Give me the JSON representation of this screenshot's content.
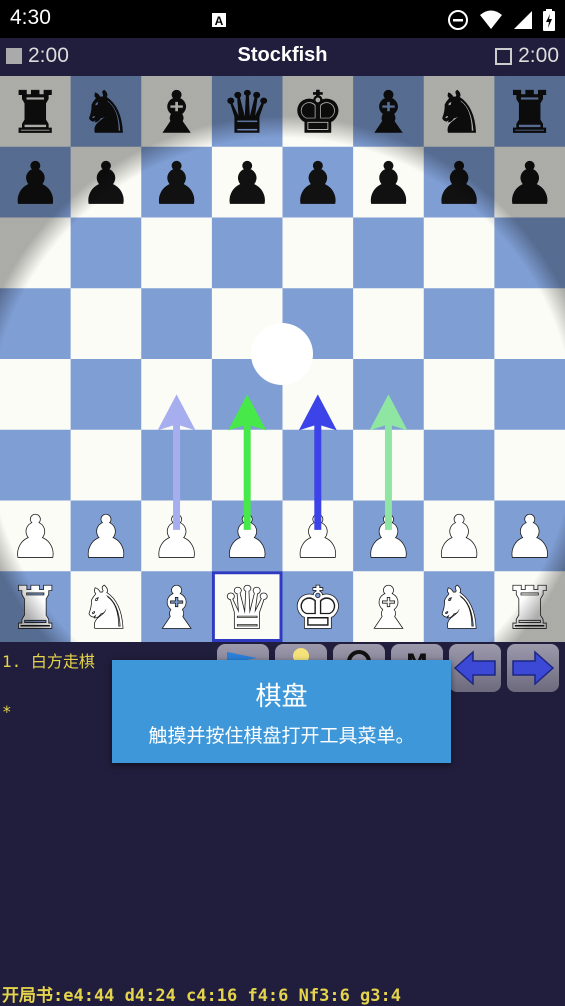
{
  "status_bar": {
    "time": "4:30",
    "icons": [
      "notification-a-icon",
      "do-not-disturb-icon",
      "wifi-icon",
      "signal-icon",
      "battery-charging-icon"
    ]
  },
  "clock_bar": {
    "left_time": "2:00",
    "engine_name": "Stockfish",
    "right_time": "2:00"
  },
  "board": {
    "colors": {
      "light": "#fcfcf6",
      "dark": "#7f9ed4",
      "highlight": "#2e3ac0"
    },
    "ranks": [
      [
        "br",
        "bn",
        "bb",
        "bq",
        "bk",
        "bb",
        "bn",
        "br"
      ],
      [
        "bp",
        "bp",
        "bp",
        "bp",
        "bp",
        "bp",
        "bp",
        "bp"
      ],
      [
        "",
        "",
        "",
        "",
        "",
        "",
        "",
        ""
      ],
      [
        "",
        "",
        "",
        "",
        "",
        "",
        "",
        ""
      ],
      [
        "",
        "",
        "",
        "",
        "",
        "",
        "",
        ""
      ],
      [
        "",
        "",
        "",
        "",
        "",
        "",
        "",
        ""
      ],
      [
        "wp",
        "wp",
        "wp",
        "wp",
        "wp",
        "wp",
        "wp",
        "wp"
      ],
      [
        "wr",
        "wn",
        "wb",
        "wq",
        "wk",
        "wb",
        "wn",
        "wr"
      ]
    ],
    "highlighted_square": "d1",
    "arrows": [
      {
        "from": "c2",
        "to": "c4",
        "color": "#a7aef0"
      },
      {
        "from": "d2",
        "to": "d4",
        "color": "#47e84a"
      },
      {
        "from": "e2",
        "to": "e4",
        "color": "#3c43e8"
      },
      {
        "from": "f2",
        "to": "f4",
        "color": "#8ee6a2"
      }
    ]
  },
  "move_list": {
    "line1": "1. 白方走棋",
    "line2": "*"
  },
  "toolbar": {
    "buttons": [
      "flip-board-icon",
      "mode-icon",
      "undo-icon",
      "menu-icon",
      "back-arrow-icon",
      "forward-arrow-icon"
    ]
  },
  "tooltip": {
    "title": "棋盘",
    "body": "触摸并按住棋盘打开工具菜单。"
  },
  "book_line": "开局书:e4:44 d4:24 c4:16 f4:6 Nf3:6 g3:4"
}
